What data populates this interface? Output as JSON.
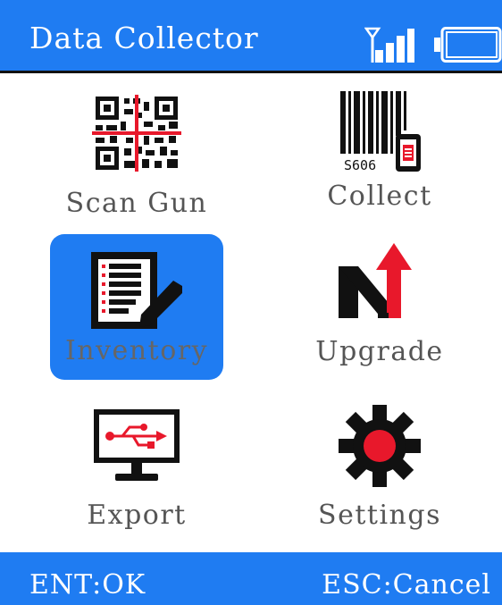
{
  "header": {
    "title": "Data Collector",
    "signal_icon": "signal-strength-icon",
    "battery_icon": "battery-icon"
  },
  "menu": {
    "selected": "Inventory",
    "items": [
      {
        "label": "Scan Gun",
        "icon": "qr-code-scan-icon"
      },
      {
        "label": "Collect",
        "icon": "barcode-collector-icon",
        "icon_text": "S606"
      },
      {
        "label": "Inventory",
        "icon": "inventory-list-icon"
      },
      {
        "label": "Upgrade",
        "icon": "upgrade-arrow-icon"
      },
      {
        "label": "Export",
        "icon": "usb-monitor-icon"
      },
      {
        "label": "Settings",
        "icon": "gear-icon"
      }
    ]
  },
  "footer": {
    "ok_label": "ENT:OK",
    "cancel_label": "ESC:Cancel"
  },
  "colors": {
    "accent": "#1f7cf2",
    "icon_red": "#e8182b",
    "label_gray": "#555555"
  }
}
